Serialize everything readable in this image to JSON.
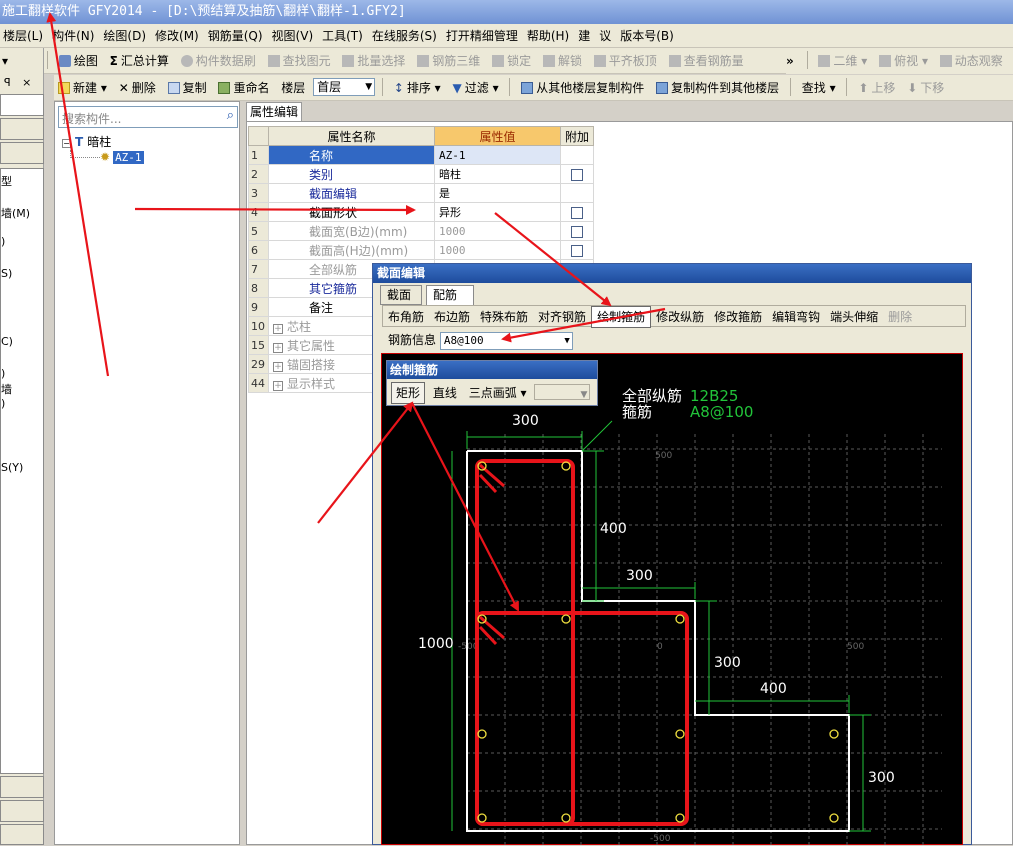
{
  "window": {
    "title": "施工翻样软件 GFY2014 - [D:\\预结算及抽筋\\翻样\\翻样-1.GFY2]"
  },
  "menu": [
    "楼层(L)",
    "构件(N)",
    "绘图(D)",
    "修改(M)",
    "钢筋量(Q)",
    "视图(V)",
    "工具(T)",
    "在线服务(S)",
    "打开精细管理",
    "帮助(H)",
    "建",
    "议",
    "版本号(B)"
  ],
  "toolbar1": {
    "draw": "绘图",
    "sum": "汇总计算",
    "component_brush": "构件数据刷",
    "find_element": "查找图元",
    "batch_select": "批量选择",
    "rebar_3d": "钢筋三维",
    "unlock": "解锁",
    "lock": "锁定",
    "align_slab": "平齐板顶",
    "view_rebar": "查看钢筋量",
    "view_mode": "二维",
    "overlook": "俯视",
    "dynamic": "动态观察"
  },
  "toolbar2": {
    "new": "新建",
    "delete": "删除",
    "copy": "复制",
    "rename": "重命名",
    "floor_label": "楼层",
    "floor_value": "首层",
    "sort": "排序",
    "filter": "过滤",
    "copy_from": "从其他楼层复制构件",
    "copy_to": "复制构件到其他楼层",
    "find": "查找",
    "up": "上移",
    "down": "下移"
  },
  "left_panel": {
    "close": "×",
    "pin": "ꟼ",
    "items": [
      "型",
      "墙(M)",
      ")",
      "S)",
      "C)",
      ")",
      "墙",
      ")",
      "S(Y)"
    ]
  },
  "tree": {
    "search_placeholder": "搜索构件...",
    "root": "暗柱",
    "child": "AZ-1"
  },
  "properties": {
    "tab": "属性编辑",
    "headers": [
      "属性名称",
      "属性值",
      "附加"
    ],
    "rows": [
      {
        "no": "1",
        "name": "名称",
        "value": "AZ-1",
        "check": false,
        "style": "sel"
      },
      {
        "no": "2",
        "name": "类别",
        "value": "暗柱",
        "check": true,
        "style": "blue"
      },
      {
        "no": "3",
        "name": "截面编辑",
        "value": "是",
        "check": false,
        "style": "blue"
      },
      {
        "no": "4",
        "name": "截面形状",
        "value": "异形",
        "check": true,
        "style": ""
      },
      {
        "no": "5",
        "name": "截面宽(B边)(mm)",
        "value": "1000",
        "check": true,
        "style": "grey"
      },
      {
        "no": "6",
        "name": "截面高(H边)(mm)",
        "value": "1000",
        "check": true,
        "style": "grey"
      },
      {
        "no": "7",
        "name": "全部纵筋",
        "value": "",
        "check": false,
        "style": "grey"
      },
      {
        "no": "8",
        "name": "其它箍筋",
        "value": "",
        "check": false,
        "style": "blue"
      },
      {
        "no": "9",
        "name": "备注",
        "value": "",
        "check": false,
        "style": ""
      },
      {
        "no": "10",
        "name": "芯柱",
        "value": "",
        "check": false,
        "style": "grey",
        "expand": true
      },
      {
        "no": "15",
        "name": "其它属性",
        "value": "",
        "check": false,
        "style": "grey",
        "expand": true
      },
      {
        "no": "29",
        "name": "锚固搭接",
        "value": "",
        "check": false,
        "style": "grey",
        "expand": true
      },
      {
        "no": "44",
        "name": "显示样式",
        "value": "",
        "check": false,
        "style": "grey",
        "expand": true
      }
    ]
  },
  "section_dialog": {
    "title": "截面编辑",
    "tabs": [
      "截面",
      "配筋"
    ],
    "subtools": [
      "布角筋",
      "布边筋",
      "特殊布筋",
      "对齐钢筋",
      "绘制箍筋",
      "修改纵筋",
      "修改箍筋",
      "编辑弯钩",
      "端头伸缩",
      "删除"
    ],
    "rebar_info_label": "钢筋信息",
    "rebar_info_value": "A8@100",
    "draw_panel": {
      "title": "绘制箍筋",
      "buttons": [
        "矩形",
        "直线",
        "三点画弧"
      ]
    },
    "canvas": {
      "label_all": "全部纵筋",
      "label_stirrup": "箍筋",
      "val_all": "12B25",
      "val_stirrup": "A8@100",
      "dims": [
        "300",
        "400",
        "300",
        "300",
        "400",
        "300",
        "1000"
      ],
      "grid_labels": [
        "500",
        "-500",
        "0",
        "500",
        "-500"
      ]
    }
  },
  "colors": {
    "annotation": "#e8141a",
    "dim": "#22c43a",
    "rebar": "#f0e040"
  }
}
